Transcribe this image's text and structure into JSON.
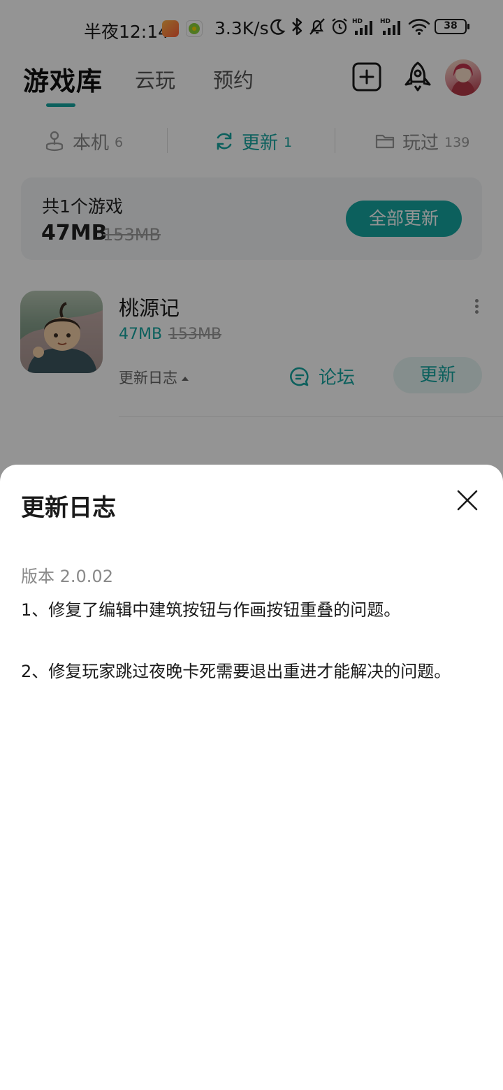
{
  "status_bar": {
    "time": "半夜12:14",
    "net_speed": "3.3K/s",
    "battery": "38",
    "signal_label_1": "HD",
    "signal_label_2": "HD"
  },
  "header": {
    "tabs": [
      {
        "label": "游戏库",
        "active": true
      },
      {
        "label": "云玩",
        "active": false
      },
      {
        "label": "预约",
        "active": false
      }
    ],
    "icons": [
      "add-square-icon",
      "rocket-icon",
      "avatar"
    ]
  },
  "filters": [
    {
      "label": "本机",
      "count": "6",
      "icon": "joystick-icon",
      "active": false
    },
    {
      "label": "更新",
      "count": "1",
      "icon": "refresh-icon",
      "active": true
    },
    {
      "label": "玩过",
      "count": "139",
      "icon": "folder-icon",
      "active": false
    }
  ],
  "summary": {
    "title": "共1个游戏",
    "size": "47MB",
    "original_size": "153MB",
    "update_all_label": "全部更新"
  },
  "game": {
    "name": "桃源记",
    "size": "47MB",
    "original_size": "153MB",
    "changelog_label": "更新日志",
    "forum_label": "论坛",
    "update_label": "更新"
  },
  "sheet": {
    "title": "更新日志",
    "version": "版本 2.0.02",
    "notes": [
      "1、修复了编辑中建筑按钮与作画按钮重叠的问题。",
      "2、修复玩家跳过夜晚卡死需要退出重进才能解决的问题。"
    ]
  },
  "colors": {
    "accent": "#16a5a0",
    "overlay": "rgba(0,0,0,0.42)"
  }
}
